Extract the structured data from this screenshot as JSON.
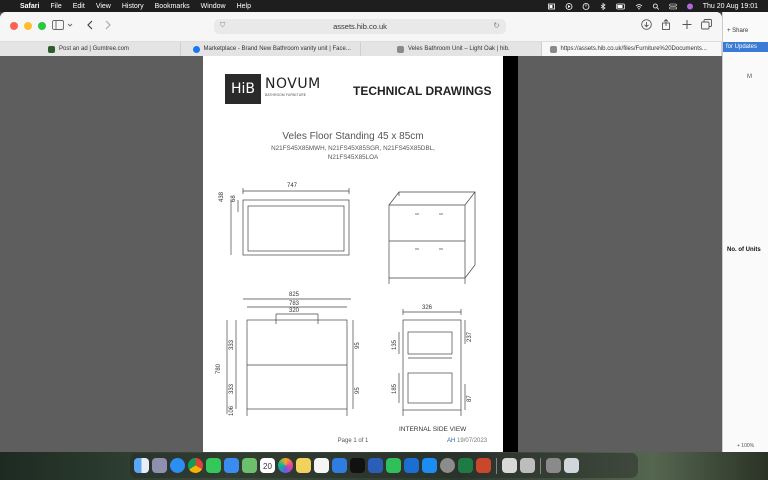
{
  "menubar": {
    "app": "Safari",
    "items": [
      "File",
      "Edit",
      "View",
      "History",
      "Bookmarks",
      "Window",
      "Help"
    ],
    "datetime": "Thu 20 Aug  19:01"
  },
  "browser": {
    "address": "assets.hib.co.uk",
    "tabs": [
      {
        "label": "Post an ad | Gumtree.com",
        "color": "#2e5d2e"
      },
      {
        "label": "Marketplace - Brand New Bathroom vanity unit | Face...",
        "color": "#1877f2"
      },
      {
        "label": "Veles Bathroom Unit – Light Oak | hib.",
        "color": "#8a8a8a"
      },
      {
        "label": "https://assets.hib.co.uk/files/Furniture%20Documents...",
        "color": "#8a8a8a"
      }
    ]
  },
  "pdf": {
    "logo_hib": "HiB",
    "logo_novum": "NOVUM",
    "logo_sub": "BATHROOM FURNITURE",
    "heading": "TECHNICAL DRAWINGS",
    "product_title": "Veles Floor Standing 45 x 85cm",
    "product_codes": "N21FS45X85MWH, N21FS45X85SGR, N21FS45X85DBL, N21FS45X85LOA",
    "dims": {
      "top_width": "747",
      "top_depth": "438",
      "top_inner": "68",
      "front_width": "825",
      "front_inner": "783",
      "handle_width": "320",
      "height_total": "780",
      "drawer_upper": "333",
      "drawer_lower": "333",
      "plinth": "106",
      "handle_drop_upper": "95",
      "handle_drop_lower": "95",
      "side_depth": "326",
      "side_top": "237",
      "side_upper": "135",
      "side_lower": "185",
      "side_bottom": "87"
    },
    "side_caption": "INTERNAL SIDE VIEW",
    "page_label": "Page 1 of 1",
    "rev_initials": "AH",
    "rev_date": "19/07/2023"
  },
  "background_app": {
    "share": "+ Share",
    "updates": "for Updates",
    "column": "M",
    "header": "No. of Units",
    "zoom": "+ 100%"
  },
  "dock": {
    "calendar_day": "20",
    "icons": [
      "finder-icon",
      "launchpad-icon",
      "safari-icon",
      "chrome-icon",
      "messages-icon",
      "mail-icon",
      "maps-icon",
      "calendar-icon",
      "photos-icon",
      "notes-icon",
      "reminders-icon",
      "keynote-icon",
      "appletv-icon",
      "word-icon",
      "facetime-icon",
      "outlook-icon",
      "appstore-icon",
      "systemprefs-icon",
      "excel-icon",
      "powerpoint-icon",
      "preview-icon",
      "printer-icon",
      "downloads-icon",
      "trash-icon"
    ]
  }
}
